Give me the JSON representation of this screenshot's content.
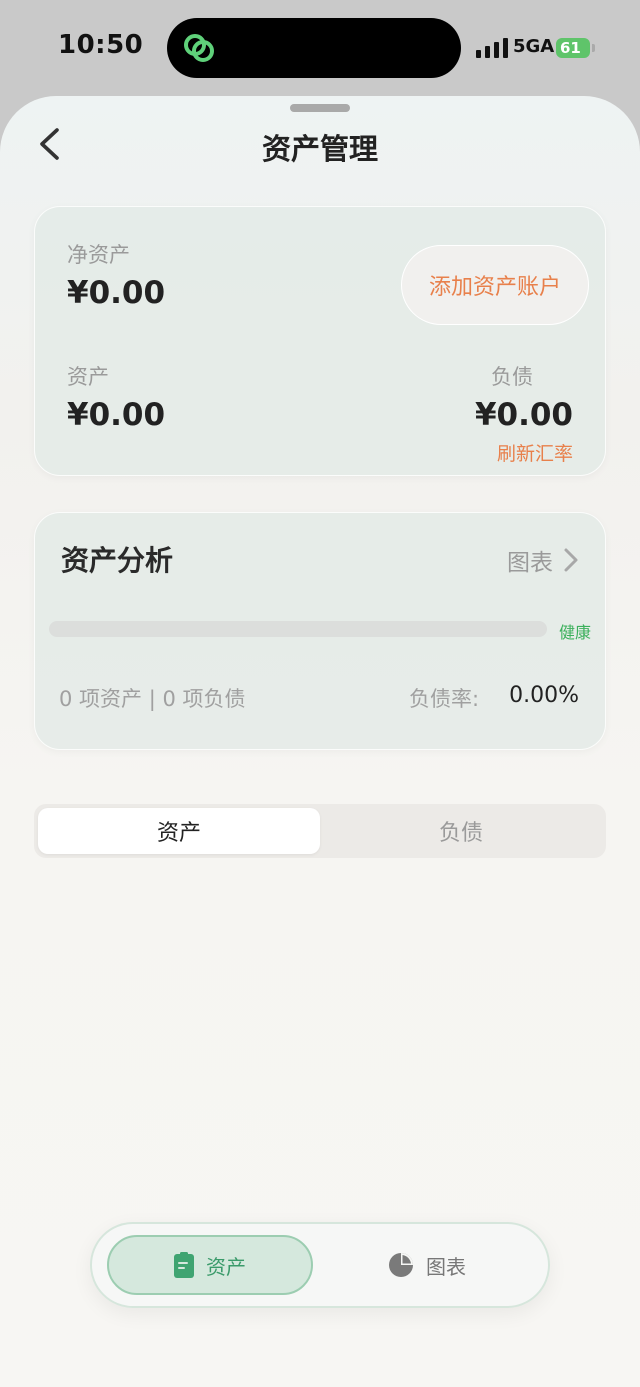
{
  "status_bar": {
    "time": "10:50",
    "network": "5GA",
    "battery": "61",
    "island_icon": "link-rings-icon",
    "colors": {
      "battery": "#5fc46a",
      "island_icon": "#5fd17a"
    }
  },
  "header": {
    "title": "资产管理",
    "back_icon": "chevron-left-icon"
  },
  "summary": {
    "net_label": "净资产",
    "net_value": "¥0.00",
    "add_button": "添加资产账户",
    "assets_label": "资产",
    "assets_value": "¥0.00",
    "liabilities_label": "负债",
    "liabilities_value": "¥0.00",
    "refresh_rate": "刷新汇率"
  },
  "analysis": {
    "title": "资产分析",
    "chart_link": "图表",
    "health_progress": 0,
    "health_label": "健康",
    "counts": "0 项资产 | 0 项负债",
    "ratio_label": "负债率:",
    "ratio_value": "0.00%"
  },
  "segment": {
    "tabs": [
      {
        "label": "资产",
        "selected": true
      },
      {
        "label": "负债",
        "selected": false
      }
    ]
  },
  "tabbar": {
    "items": [
      {
        "label": "资产",
        "icon": "clipboard-icon",
        "selected": true
      },
      {
        "label": "图表",
        "icon": "pie-chart-icon",
        "selected": false
      }
    ]
  },
  "colors": {
    "accent_orange": "#e8804b",
    "health_green": "#3cb05c",
    "tab_active_green": "#3a9a6a"
  }
}
